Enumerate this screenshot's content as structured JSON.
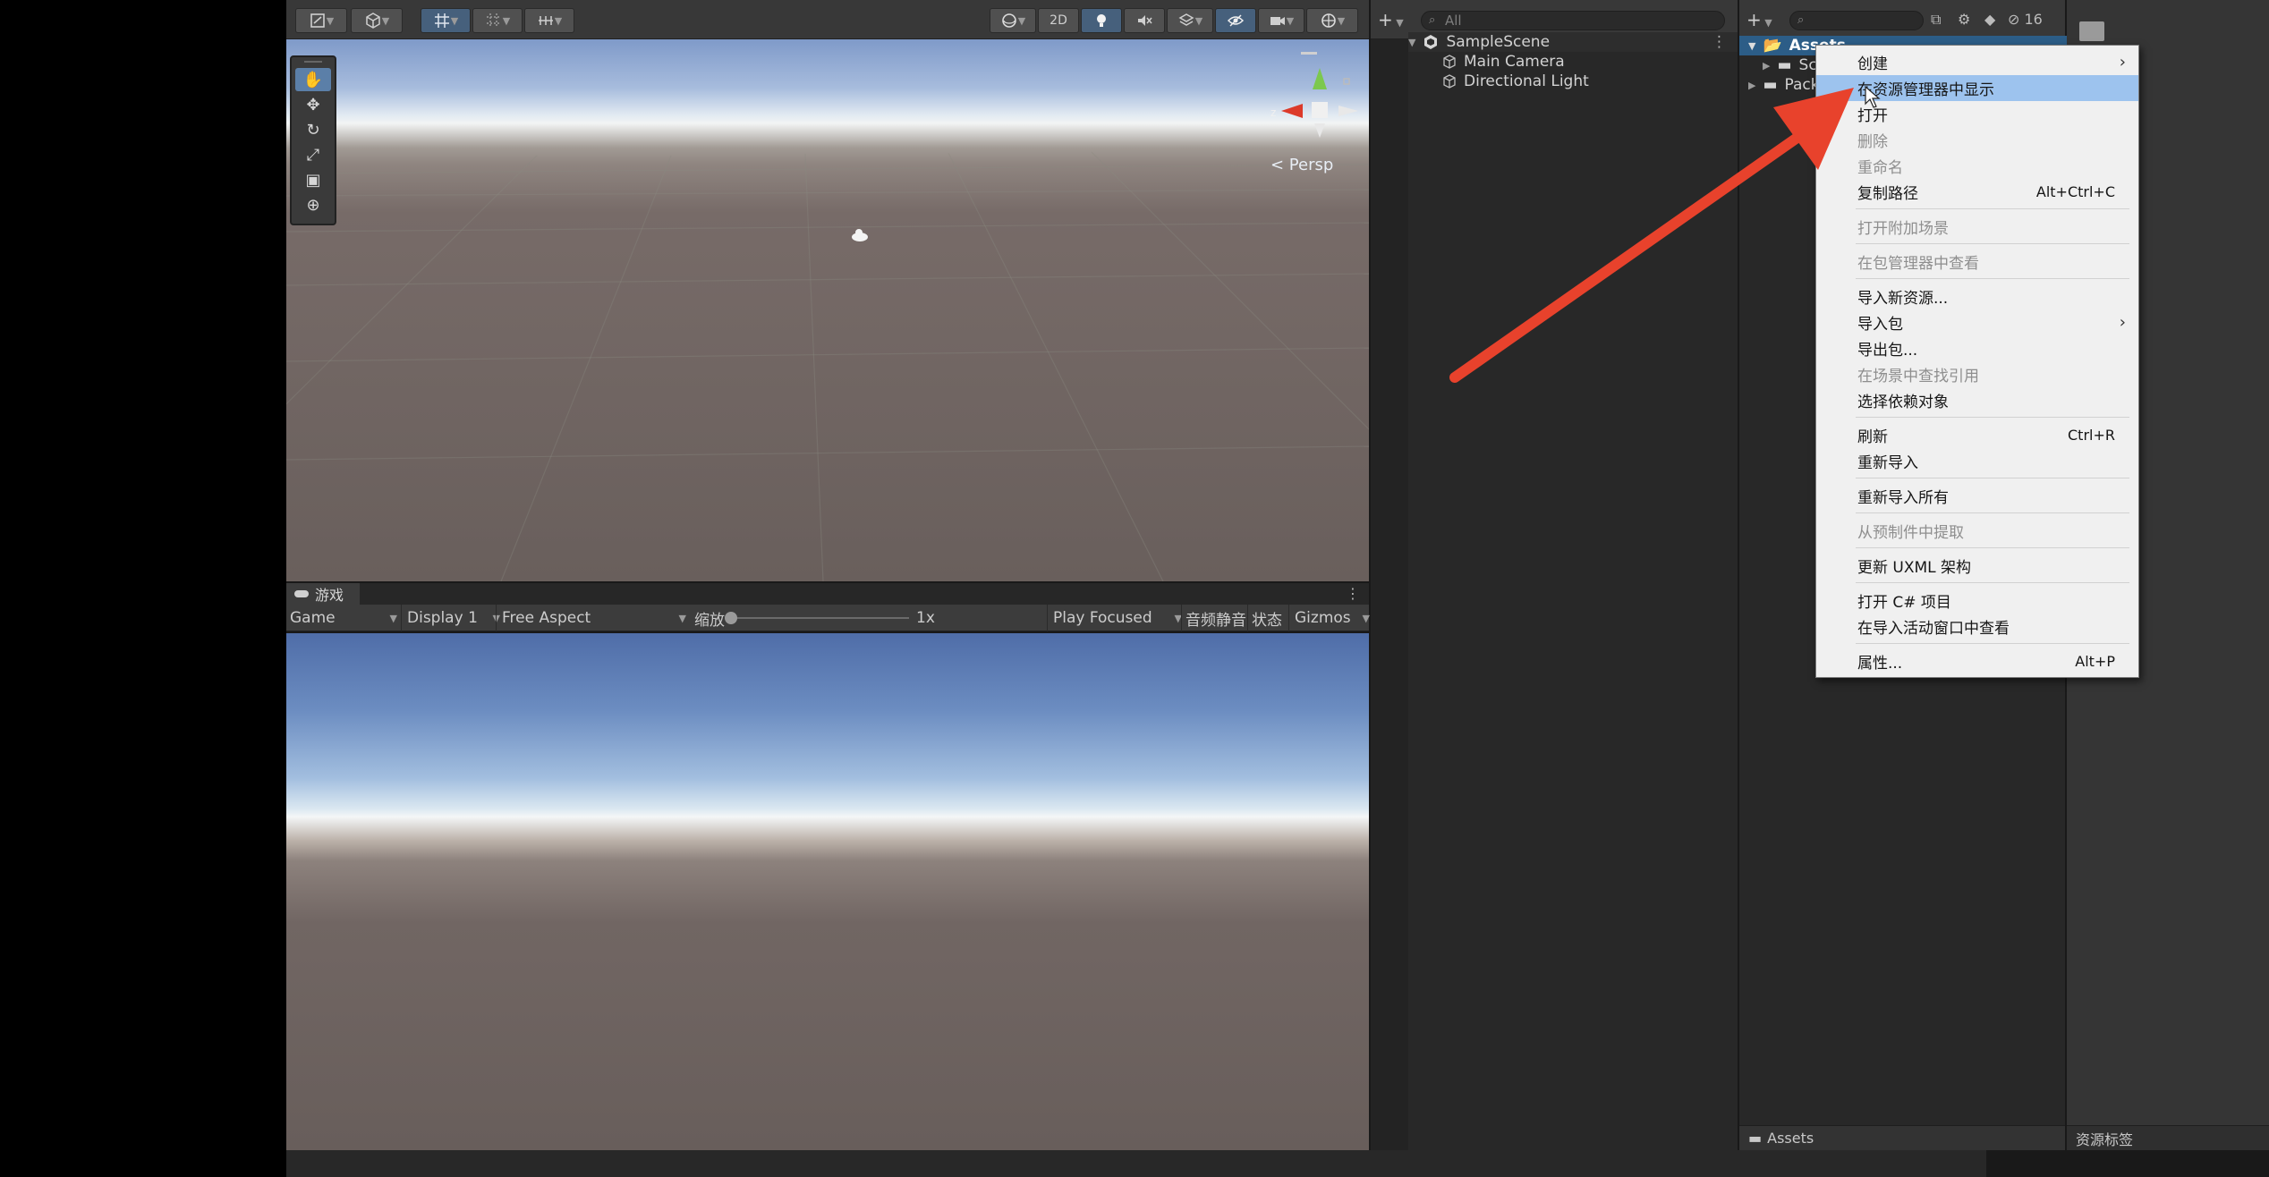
{
  "scene": {
    "btn_2d": "2D",
    "persp_label": "< Persp"
  },
  "game": {
    "tab_label": "游戏",
    "mode": "Game",
    "display": "Display 1",
    "aspect": "Free Aspect",
    "scale_label": "缩放",
    "scale_value": "1x",
    "play_mode": "Play Focused",
    "mute": "音频静音",
    "stats": "状态",
    "gizmos": "Gizmos"
  },
  "hierarchy": {
    "search_placeholder": "All",
    "scene_name": "SampleScene",
    "objects": [
      "Main Camera",
      "Directional Light"
    ]
  },
  "project": {
    "hidden_count": "16",
    "tree": [
      {
        "label": "Assets",
        "type": "folder-open"
      },
      {
        "label": "Sce",
        "type": "folder"
      },
      {
        "label": "Pack",
        "type": "folder"
      }
    ],
    "footer_path": "Assets"
  },
  "inspector": {
    "footer_label": "资源标签"
  },
  "context_menu": {
    "items": [
      {
        "label": "创建",
        "shortcut": "",
        "submenu": true,
        "disabled": false,
        "highlighted": false
      },
      {
        "label": "在资源管理器中显示",
        "shortcut": "",
        "submenu": false,
        "disabled": false,
        "highlighted": true
      },
      {
        "label": "打开",
        "shortcut": "",
        "submenu": false,
        "disabled": false,
        "highlighted": false
      },
      {
        "label": "删除",
        "shortcut": "",
        "submenu": false,
        "disabled": true,
        "highlighted": false
      },
      {
        "label": "重命名",
        "shortcut": "",
        "submenu": false,
        "disabled": true,
        "highlighted": false
      },
      {
        "label": "复制路径",
        "shortcut": "Alt+Ctrl+C",
        "submenu": false,
        "disabled": false,
        "highlighted": false
      },
      {
        "label": "打开附加场景",
        "shortcut": "",
        "submenu": false,
        "disabled": true,
        "highlighted": false
      },
      {
        "label": "在包管理器中查看",
        "shortcut": "",
        "submenu": false,
        "disabled": true,
        "highlighted": false
      },
      {
        "label": "导入新资源...",
        "shortcut": "",
        "submenu": false,
        "disabled": false,
        "highlighted": false
      },
      {
        "label": "导入包",
        "shortcut": "",
        "submenu": true,
        "disabled": false,
        "highlighted": false
      },
      {
        "label": "导出包...",
        "shortcut": "",
        "submenu": false,
        "disabled": false,
        "highlighted": false
      },
      {
        "label": "在场景中查找引用",
        "shortcut": "",
        "submenu": false,
        "disabled": true,
        "highlighted": false
      },
      {
        "label": "选择依赖对象",
        "shortcut": "",
        "submenu": false,
        "disabled": false,
        "highlighted": false
      },
      {
        "label": "刷新",
        "shortcut": "Ctrl+R",
        "submenu": false,
        "disabled": false,
        "highlighted": false
      },
      {
        "label": "重新导入",
        "shortcut": "",
        "submenu": false,
        "disabled": false,
        "highlighted": false
      },
      {
        "label": "重新导入所有",
        "shortcut": "",
        "submenu": false,
        "disabled": false,
        "highlighted": false
      },
      {
        "label": "从预制件中提取",
        "shortcut": "",
        "submenu": false,
        "disabled": true,
        "highlighted": false
      },
      {
        "label": "更新 UXML 架构",
        "shortcut": "",
        "submenu": false,
        "disabled": false,
        "highlighted": false
      },
      {
        "label": "打开 C# 项目",
        "shortcut": "",
        "submenu": false,
        "disabled": false,
        "highlighted": false
      },
      {
        "label": "在导入活动窗口中查看",
        "shortcut": "",
        "submenu": false,
        "disabled": false,
        "highlighted": false
      },
      {
        "label": "属性...",
        "shortcut": "Alt+P",
        "submenu": false,
        "disabled": false,
        "highlighted": false
      }
    ]
  },
  "colors": {
    "annotation_arrow": "#e8422c",
    "menu_highlight": "#9dc3ee",
    "editor_dark": "#282828"
  }
}
